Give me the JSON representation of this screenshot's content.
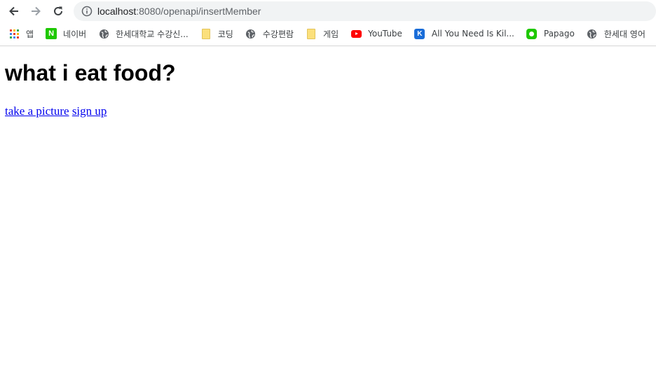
{
  "browser": {
    "url_host": "localhost",
    "url_path": ":8080/openapi/insertMember",
    "nav": {
      "back_icon": "arrow-left-icon",
      "forward_icon": "arrow-right-icon",
      "reload_icon": "reload-icon"
    }
  },
  "bookmarks": [
    {
      "label": "앱",
      "icon": "apps-grid-icon"
    },
    {
      "label": "네이버",
      "icon": "naver-icon"
    },
    {
      "label": "한세대학교 수강신...",
      "icon": "globe-icon"
    },
    {
      "label": "코딩",
      "icon": "folder-icon"
    },
    {
      "label": "수강편람",
      "icon": "globe-icon"
    },
    {
      "label": "게임",
      "icon": "folder-icon"
    },
    {
      "label": "YouTube",
      "icon": "youtube-icon"
    },
    {
      "label": "All You Need Is Kil...",
      "icon": "k-icon"
    },
    {
      "label": "Papago",
      "icon": "papago-icon"
    },
    {
      "label": "한세대 영어",
      "icon": "globe-icon"
    }
  ],
  "page": {
    "title": "what i eat food?",
    "links": [
      {
        "label": "take a picture"
      },
      {
        "label": "sign up"
      }
    ]
  },
  "colors": {
    "link": "#0000ee",
    "naver": "#1ec800",
    "youtube": "#ff0000",
    "address_bar_bg": "#f1f3f4"
  }
}
